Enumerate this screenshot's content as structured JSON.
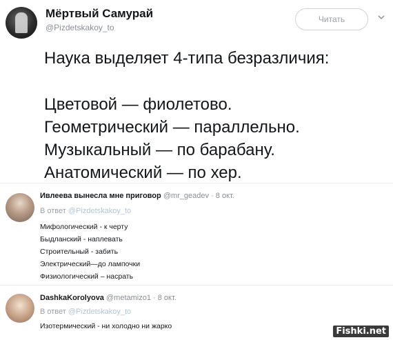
{
  "tweet": {
    "author_name": "Мёртвый Самурай",
    "author_handle": "@Pizdetskakoy_to",
    "follow_label": "Читать",
    "lines": [
      "Наука выделяет 4-типа безразличия:",
      "Цветовой — фиолетово.",
      "Геометрический — параллельно.",
      "Музыкальный — по барабану.",
      "Анатомический — по хер."
    ]
  },
  "replies": [
    {
      "name": "Ивлеева вынесла мне приговор",
      "meta": "@mr_geadev · 8 окт.",
      "reply_to_prefix": "В ответ",
      "reply_to_handle": "@Pizdetskakoy_to",
      "lines": [
        "Мифологический - к черту",
        "Быдланский - наплевать",
        "Строительный - забить",
        "Электрический—до лампочки",
        "Физиологический – насрать"
      ]
    },
    {
      "name": "DashkaKorolyova",
      "meta": "@metamizo1 · 8 окт.",
      "reply_to_prefix": "В ответ",
      "reply_to_handle": "@Pizdetskakoy_to",
      "lines": [
        "Изотермический - ни холодно ни жарко"
      ]
    }
  ],
  "watermark": "Fishki.net",
  "icons": {
    "avatar": "avatar",
    "chevron": "chevron-down-icon"
  },
  "colors": {
    "text": "#14171a",
    "muted": "#8a8f94",
    "border": "#cfd3d6"
  }
}
